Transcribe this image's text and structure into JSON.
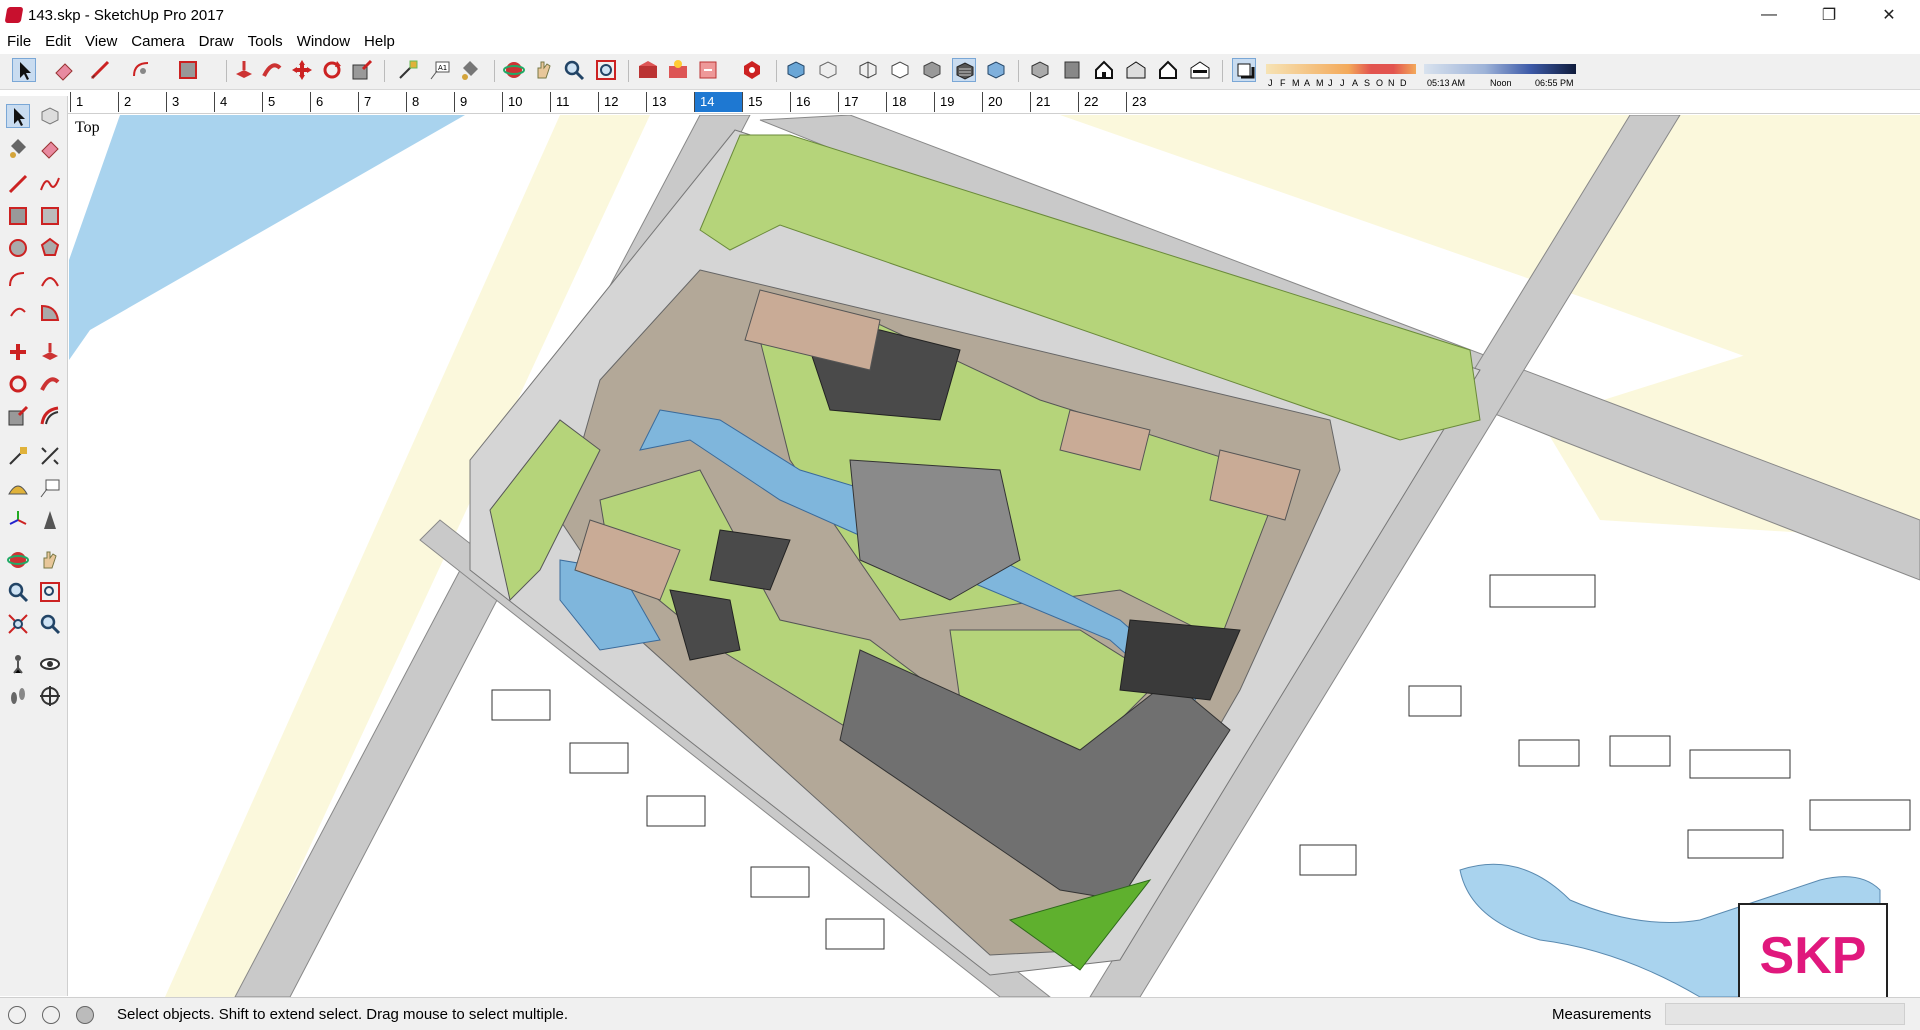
{
  "window": {
    "title": "143.skp - SketchUp Pro 2017",
    "minimize_glyph": "—",
    "maximize_glyph": "❐",
    "close_glyph": "✕"
  },
  "menu": {
    "items": [
      "File",
      "Edit",
      "View",
      "Camera",
      "Draw",
      "Tools",
      "Window",
      "Help"
    ]
  },
  "shadow_panel": {
    "months": [
      "J",
      "F",
      "M",
      "A",
      "M",
      "J",
      "J",
      "A",
      "S",
      "O",
      "N",
      "D"
    ],
    "time_start": "05:13 AM",
    "time_mid": "Noon",
    "time_end": "06:55 PM"
  },
  "scenes": {
    "tabs": [
      "1",
      "2",
      "3",
      "4",
      "5",
      "6",
      "7",
      "8",
      "9",
      "10",
      "11",
      "12",
      "13",
      "14",
      "15",
      "16",
      "17",
      "18",
      "19",
      "20",
      "21",
      "22",
      "23"
    ],
    "active_index": 13
  },
  "viewport": {
    "view_name": "Top"
  },
  "status": {
    "message": "Select objects. Shift to extend select. Drag mouse to select multiple.",
    "measurements_label": "Measurements",
    "measurements_value": ""
  },
  "watermark": {
    "text": "SKP"
  },
  "colors": {
    "road": "#c9c9c9",
    "grass": "#b5d47a",
    "water": "#a9d3ee",
    "plaza": "#b3a898",
    "building_dark": "#6f6f6f",
    "roof_brick": "#c9ab96",
    "accent_scene": "#1e78d2"
  }
}
